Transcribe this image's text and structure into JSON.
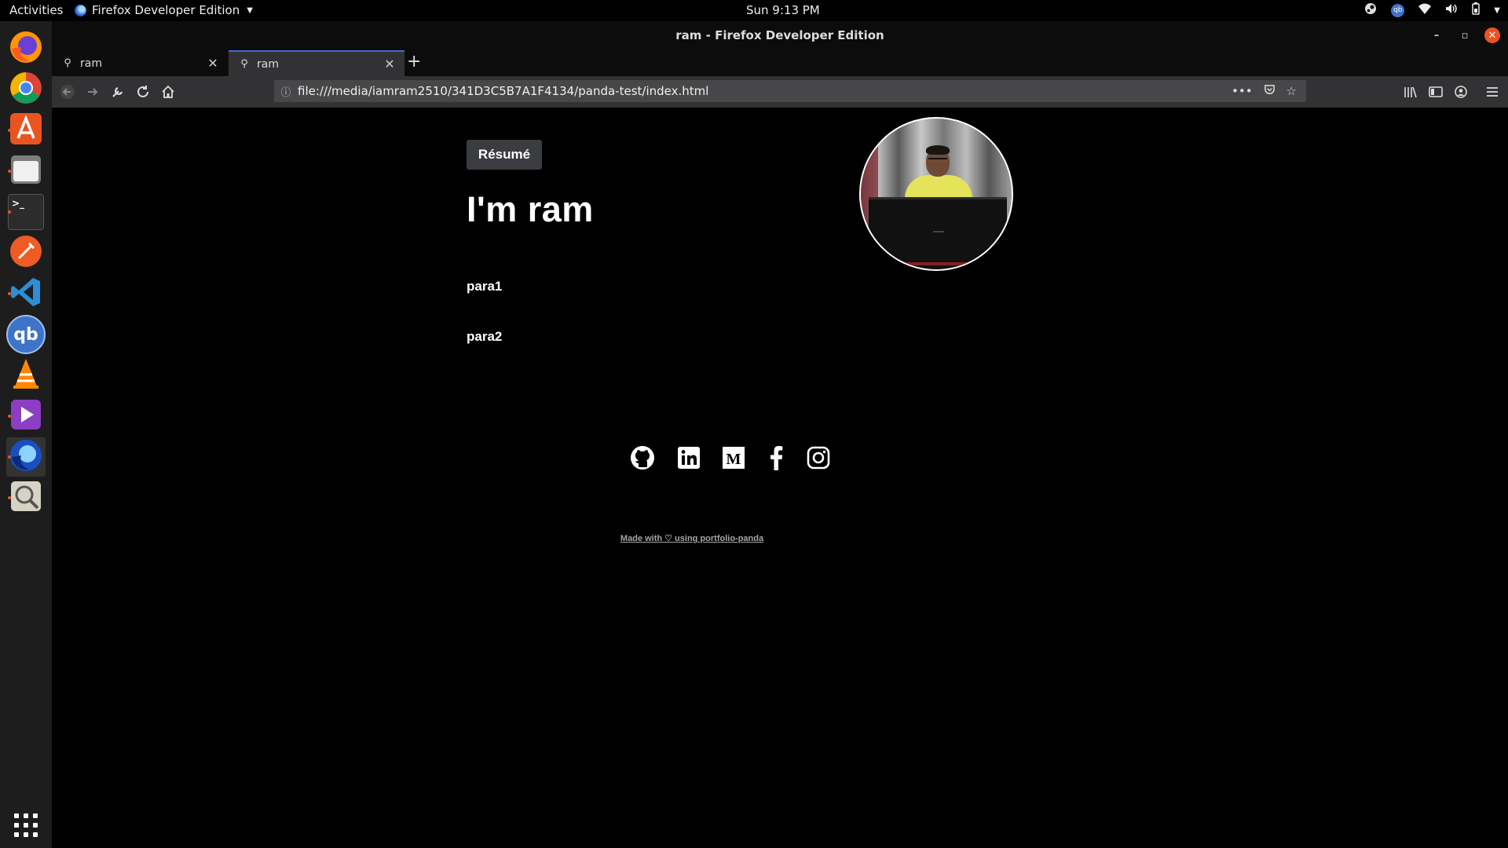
{
  "system_bar": {
    "activities": "Activities",
    "app_name": "Firefox Developer Edition",
    "clock": "Sun  9:13 PM",
    "tray_icons": [
      "steam-icon",
      "qbittorrent-tray-icon",
      "wifi-icon",
      "volume-icon",
      "battery-icon",
      "system-menu-caret-icon"
    ],
    "qb_tray_text": "qb"
  },
  "dock": {
    "items": [
      "firefox",
      "chrome",
      "software-center",
      "files",
      "terminal",
      "postman",
      "vscode",
      "qbittorrent",
      "vlc",
      "media-player",
      "firefox-developer-edition",
      "image-viewer"
    ],
    "qb_label": "qb",
    "terminal_label": ">_"
  },
  "window": {
    "title": "ram - Firefox Developer Edition"
  },
  "tabs": [
    {
      "label": "ram",
      "selected": false
    },
    {
      "label": "ram",
      "selected": true
    }
  ],
  "navbar": {
    "url": "file:///media/iamram2510/341D3C5B7A1F4134/panda-test/index.html"
  },
  "page": {
    "resume_label": "Résumé",
    "headline": "I'm ram",
    "para1": "para1",
    "para2": "para2",
    "social_links": [
      "github",
      "linkedin",
      "medium",
      "facebook",
      "instagram"
    ],
    "medium_letter": "M",
    "facebook_letter": "f",
    "footer": "Made with ♡ using portfolio-panda"
  },
  "colors": {
    "background": "#000000",
    "tab_accent": "#3d6dd9",
    "toolbar": "#323234",
    "urlbar": "#474749",
    "close_button": "#e95420",
    "resume_button": "#3b3c40"
  }
}
